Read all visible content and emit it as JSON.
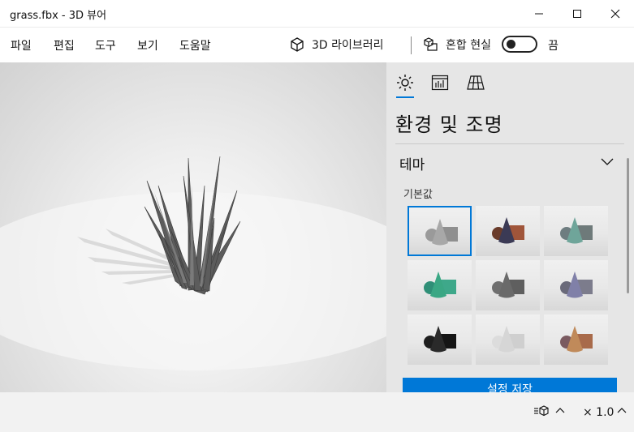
{
  "window": {
    "title": "grass.fbx - 3D 뷰어"
  },
  "menu": {
    "items": [
      {
        "label": "파일"
      },
      {
        "label": "편집"
      },
      {
        "label": "도구"
      },
      {
        "label": "보기"
      },
      {
        "label": "도움말"
      }
    ],
    "library_label": "3D 라이브러리",
    "mixed_reality_label": "혼합 현실",
    "toggle_state_label": "끔"
  },
  "panel": {
    "title": "환경 및 조명",
    "section_label": "테마",
    "theme_group_label": "기본값",
    "save_label": "설정 저장",
    "themes": [
      {
        "name": "gray",
        "sphere": "#9a9a9a",
        "cone": "#a8a8a8",
        "box": "#8f8f8f",
        "selected": true
      },
      {
        "name": "dusk",
        "sphere": "#6a3b2a",
        "cone": "#3b3a55",
        "box": "#a0553a",
        "selected": false
      },
      {
        "name": "teal-gray",
        "sphere": "#6e7d80",
        "cone": "#6fa59a",
        "box": "#6e7a7a",
        "selected": false
      },
      {
        "name": "emerald",
        "sphere": "#2f8f77",
        "cone": "#3aa784",
        "box": "#3ea88a",
        "selected": false
      },
      {
        "name": "slate",
        "sphere": "#6f6f6f",
        "cone": "#6a6a6a",
        "box": "#5f5f5f",
        "selected": false
      },
      {
        "name": "violet",
        "sphere": "#6a6a7a",
        "cone": "#8080a8",
        "box": "#7c7c8c",
        "selected": false
      },
      {
        "name": "black",
        "sphere": "#1e1e1e",
        "cone": "#2a2a2a",
        "box": "#151515",
        "selected": false
      },
      {
        "name": "white",
        "sphere": "#dcdcdc",
        "cone": "#d6d6d6",
        "box": "#cfcfcf",
        "selected": false
      },
      {
        "name": "warm",
        "sphere": "#7a5a60",
        "cone": "#c08a5a",
        "box": "#a86a4a",
        "selected": false
      }
    ]
  },
  "status": {
    "zoom": "× 1.0"
  },
  "colors": {
    "accent": "#0078d7"
  }
}
